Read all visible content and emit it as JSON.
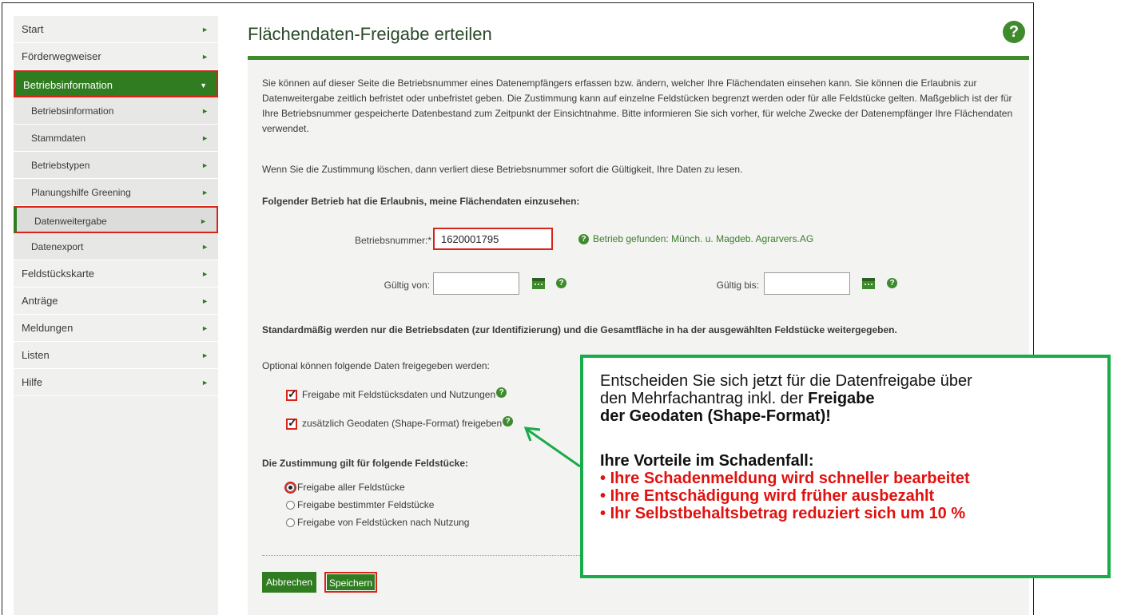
{
  "sidebar": {
    "items": [
      {
        "label": "Start"
      },
      {
        "label": "Förderwegweiser"
      },
      {
        "label": "Betriebsinformation"
      },
      {
        "label": "Betriebsinformation"
      },
      {
        "label": "Stammdaten"
      },
      {
        "label": "Betriebstypen"
      },
      {
        "label": "Planungshilfe Greening"
      },
      {
        "label": "Datenweitergabe"
      },
      {
        "label": "Datenexport"
      },
      {
        "label": "Feldstückskarte"
      },
      {
        "label": "Anträge"
      },
      {
        "label": "Meldungen"
      },
      {
        "label": "Listen"
      },
      {
        "label": "Hilfe"
      }
    ],
    "arrow_right": "►",
    "arrow_down": "▼"
  },
  "main": {
    "title": "Flächendaten-Freigabe erteilen",
    "help_symbol": "?",
    "intro": "Sie können auf dieser Seite die Betriebsnummer eines Datenempfängers erfassen bzw. ändern, welcher Ihre Flächendaten einsehen kann. Sie können die Erlaubnis zur Datenweitergabe zeitlich befristet oder unbefristet geben. Die Zustimmung kann auf einzelne Feldstücken begrenzt werden oder für alle Feldstücke gelten. Maßgeblich ist der für Ihre Betriebsnummer gespeicherte Datenbestand zum Zeitpunkt der Einsichtnahme. Bitte informieren Sie sich vorher, für welche Zwecke der Datenempfänger Ihre Flächendaten verwendet.",
    "delete_note": "Wenn Sie die Zustimmung löschen, dann verliert diese Betriebsnummer sofort die Gültigkeit, Ihre Daten zu lesen.",
    "permission_heading": "Folgender Betrieb hat die Erlaubnis, meine Flächendaten einzusehen:",
    "betriebsnummer_label": "Betriebsnummer:*",
    "betriebsnummer_value": "1620001795",
    "found_text": "Betrieb gefunden: Münch. u. Magdeb. Agrarvers.AG",
    "gueltig_von_label": "Gültig von:",
    "gueltig_von_value": "",
    "gueltig_bis_label": "Gültig bis:",
    "gueltig_bis_value": "",
    "standard_text": "Standardmäßig werden nur die Betriebsdaten (zur Identifizierung) und die Gesamtfläche in ha der ausgewählten Feldstücke weitergegeben.",
    "optional_text": "Optional können folgende Daten freigegeben werden:",
    "checkboxes": [
      {
        "label": "Freigabe mit Feldstücksdaten und Nutzungen",
        "checked": true
      },
      {
        "label": "zusätzlich Geodaten (Shape-Format) freigeben",
        "checked": true
      }
    ],
    "zustimmung_heading": "Die Zustimmung gilt für folgende Feldstücke:",
    "radios": [
      {
        "label": "Freigabe aller Feldstücke",
        "selected": true
      },
      {
        "label": "Freigabe bestimmter Feldstücke",
        "selected": false
      },
      {
        "label": "Freigabe von Feldstücken nach Nutzung",
        "selected": false
      }
    ],
    "cancel_label": "Abbrechen",
    "save_label": "Speichern"
  },
  "callout": {
    "line1": "Entscheiden Sie sich jetzt für die Datenfreigabe über",
    "line2_pre": "den Mehrfachantrag inkl. der ",
    "line2_bold": "Freigabe",
    "line3_bold": "der Geodaten (Shape-Format)!",
    "advantages_heading": "Ihre Vorteile im Schadenfall:",
    "advantages": [
      "Ihre Schadenmeldung wird schneller bearbeitet",
      "Ihre Entschädigung wird früher ausbezahlt",
      "Ihr Selbstbehaltsbetrag reduziert sich um 10 %"
    ],
    "bullet": "•"
  },
  "colors": {
    "brand_green": "#2f7d20",
    "highlight_red": "#d9241c",
    "callout_border": "#1aab4a",
    "advantage_red": "#e0120f"
  }
}
